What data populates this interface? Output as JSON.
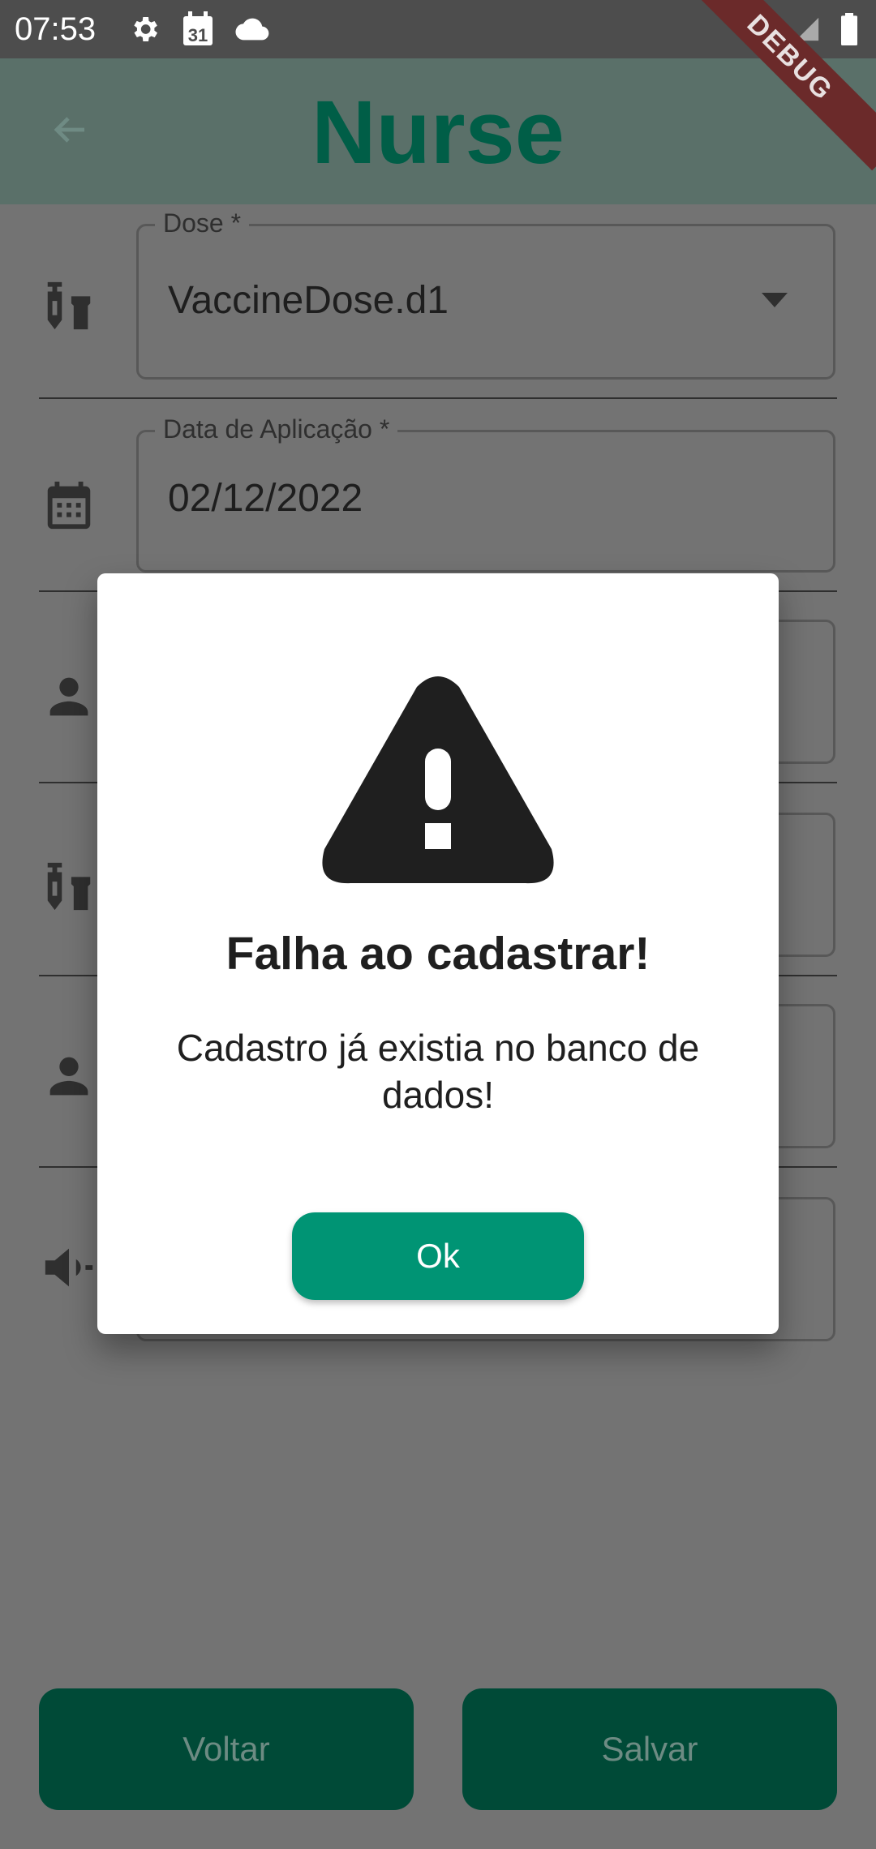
{
  "status_bar": {
    "time": "07:53",
    "icons": [
      "gear-icon",
      "calendar-icon",
      "cloud-icon",
      "wifi-icon",
      "signal-icon",
      "battery-icon"
    ],
    "calendar_day": "31"
  },
  "app_bar": {
    "title": "Nurse",
    "back_icon": "back-arrow-icon",
    "debug_label": "DEBUG"
  },
  "form": {
    "dose": {
      "label": "Dose *",
      "value": "VaccineDose.d1"
    },
    "application_date": {
      "label": "Data de Aplicação *",
      "value": "02/12/2022"
    },
    "icons": [
      "vaccine-icon",
      "calendar-icon",
      "person-icon",
      "vaccine-icon",
      "person-icon",
      "campaign-icon"
    ]
  },
  "bottom_buttons": {
    "back_label": "Voltar",
    "save_label": "Salvar"
  },
  "dialog": {
    "icon": "warning-icon",
    "title": "Falha ao cadastrar!",
    "message": "Cadastro já existia no banco de dados!",
    "ok_label": "Ok"
  },
  "colors": {
    "primary": "#009474",
    "dark_primary": "#004a37",
    "title_color": "#005e47",
    "scrim": "#737373"
  }
}
